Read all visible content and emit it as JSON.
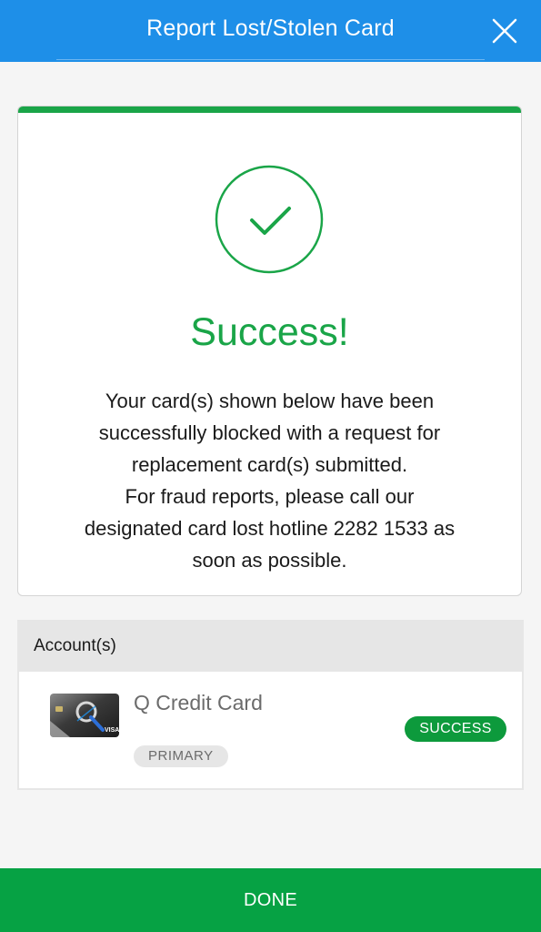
{
  "header": {
    "title": "Report Lost/Stolen Card",
    "close_icon": "close-icon",
    "background_color": "#1e8fe8"
  },
  "result": {
    "icon": "checkmark-circle-icon",
    "title": "Success!",
    "message_lines": [
      "Your card(s) shown below have been",
      "successfully blocked with a request for",
      "replacement card(s) submitted.",
      "For fraud reports, please call our",
      "designated card lost hotline 2282 1533 as",
      "soon as possible."
    ],
    "accent_color": "#1aa548"
  },
  "accounts": {
    "header_label": "Account(s)",
    "items": [
      {
        "card_image_icon": "credit-card-image",
        "name": "Q Credit Card",
        "tag": "PRIMARY",
        "status": "SUCCESS",
        "status_color": "#0d9a3c"
      }
    ]
  },
  "footer": {
    "done_label": "DONE",
    "done_color": "#06a244"
  }
}
